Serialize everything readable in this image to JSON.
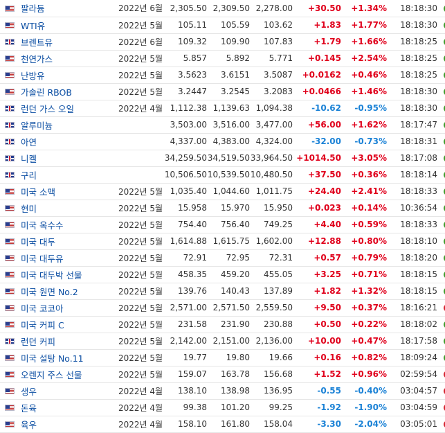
{
  "colors": {
    "positive": "#e0001b",
    "negative": "#1b82d6",
    "link": "#0a4da2",
    "open_clock": "#3b9b2a",
    "closed_clock": "#d4222d"
  },
  "rows": [
    {
      "flag": "us",
      "name": "팔라듐",
      "month": "2022년 6월",
      "last": "2,305.50",
      "high": "2,309.50",
      "low": "2,278.00",
      "chg": "+30.50",
      "pct": "+1.34%",
      "time": "18:18:30",
      "dir": "pos",
      "status": "open"
    },
    {
      "flag": "us",
      "name": "WTI유",
      "month": "2022년 5월",
      "last": "105.11",
      "high": "105.59",
      "low": "103.62",
      "chg": "+1.83",
      "pct": "+1.77%",
      "time": "18:18:30",
      "dir": "pos",
      "status": "open"
    },
    {
      "flag": "uk",
      "name": "브렌트유",
      "month": "2022년 6월",
      "last": "109.32",
      "high": "109.90",
      "low": "107.83",
      "chg": "+1.79",
      "pct": "+1.66%",
      "time": "18:18:25",
      "dir": "pos",
      "status": "open"
    },
    {
      "flag": "us",
      "name": "천연가스",
      "month": "2022년 5월",
      "last": "5.857",
      "high": "5.892",
      "low": "5.771",
      "chg": "+0.145",
      "pct": "+2.54%",
      "time": "18:18:25",
      "dir": "pos",
      "status": "open"
    },
    {
      "flag": "us",
      "name": "난방유",
      "month": "2022년 5월",
      "last": "3.5623",
      "high": "3.6151",
      "low": "3.5087",
      "chg": "+0.0162",
      "pct": "+0.46%",
      "time": "18:18:25",
      "dir": "pos",
      "status": "open"
    },
    {
      "flag": "us",
      "name": "가솔린 RBOB",
      "month": "2022년 5월",
      "last": "3.2447",
      "high": "3.2545",
      "low": "3.2083",
      "chg": "+0.0466",
      "pct": "+1.46%",
      "time": "18:18:30",
      "dir": "pos",
      "status": "open"
    },
    {
      "flag": "uk",
      "name": "런던 가스 오일",
      "month": "2022년 4월",
      "last": "1,112.38",
      "high": "1,139.63",
      "low": "1,094.38",
      "chg": "-10.62",
      "pct": "-0.95%",
      "time": "18:18:30",
      "dir": "neg",
      "status": "open"
    },
    {
      "flag": "uk",
      "name": "알루미늄",
      "month": "",
      "last": "3,503.00",
      "high": "3,516.00",
      "low": "3,477.00",
      "chg": "+56.00",
      "pct": "+1.62%",
      "time": "18:17:47",
      "dir": "pos",
      "status": "open"
    },
    {
      "flag": "uk",
      "name": "아연",
      "month": "",
      "last": "4,337.00",
      "high": "4,383.00",
      "low": "4,324.00",
      "chg": "-32.00",
      "pct": "-0.73%",
      "time": "18:18:31",
      "dir": "neg",
      "status": "open"
    },
    {
      "flag": "uk",
      "name": "니켈",
      "month": "",
      "last": "34,259.50",
      "high": "34,519.50",
      "low": "33,964.50",
      "chg": "+1014.50",
      "pct": "+3.05%",
      "time": "18:17:08",
      "dir": "pos",
      "status": "open"
    },
    {
      "flag": "uk",
      "name": "구리",
      "month": "",
      "last": "10,506.50",
      "high": "10,539.50",
      "low": "10,480.50",
      "chg": "+37.50",
      "pct": "+0.36%",
      "time": "18:18:14",
      "dir": "pos",
      "status": "open"
    },
    {
      "flag": "us",
      "name": "미국 소맥",
      "month": "2022년 5월",
      "last": "1,035.40",
      "high": "1,044.60",
      "low": "1,011.75",
      "chg": "+24.40",
      "pct": "+2.41%",
      "time": "18:18:33",
      "dir": "pos",
      "status": "open"
    },
    {
      "flag": "us",
      "name": "현미",
      "month": "2022년 5월",
      "last": "15.958",
      "high": "15.970",
      "low": "15.950",
      "chg": "+0.023",
      "pct": "+0.14%",
      "time": "10:36:54",
      "dir": "pos",
      "status": "open"
    },
    {
      "flag": "us",
      "name": "미국 옥수수",
      "month": "2022년 5월",
      "last": "754.40",
      "high": "756.40",
      "low": "749.25",
      "chg": "+4.40",
      "pct": "+0.59%",
      "time": "18:18:33",
      "dir": "pos",
      "status": "open"
    },
    {
      "flag": "us",
      "name": "미국 대두",
      "month": "2022년 5월",
      "last": "1,614.88",
      "high": "1,615.75",
      "low": "1,602.00",
      "chg": "+12.88",
      "pct": "+0.80%",
      "time": "18:18:10",
      "dir": "pos",
      "status": "open"
    },
    {
      "flag": "us",
      "name": "미국 대두유",
      "month": "2022년 5월",
      "last": "72.91",
      "high": "72.95",
      "low": "72.31",
      "chg": "+0.57",
      "pct": "+0.79%",
      "time": "18:18:20",
      "dir": "pos",
      "status": "open"
    },
    {
      "flag": "us",
      "name": "미국 대두박 선물",
      "month": "2022년 5월",
      "last": "458.35",
      "high": "459.20",
      "low": "455.05",
      "chg": "+3.25",
      "pct": "+0.71%",
      "time": "18:18:15",
      "dir": "pos",
      "status": "open"
    },
    {
      "flag": "us",
      "name": "미국 원면 No.2",
      "month": "2022년 5월",
      "last": "139.76",
      "high": "140.43",
      "low": "137.89",
      "chg": "+1.82",
      "pct": "+1.32%",
      "time": "18:18:15",
      "dir": "pos",
      "status": "open"
    },
    {
      "flag": "us",
      "name": "미국 코코아",
      "month": "2022년 5월",
      "last": "2,571.00",
      "high": "2,571.50",
      "low": "2,559.50",
      "chg": "+9.50",
      "pct": "+0.37%",
      "time": "18:16:21",
      "dir": "pos",
      "status": "closed"
    },
    {
      "flag": "us",
      "name": "미국 커피 C",
      "month": "2022년 5월",
      "last": "231.58",
      "high": "231.90",
      "low": "230.88",
      "chg": "+0.50",
      "pct": "+0.22%",
      "time": "18:18:02",
      "dir": "pos",
      "status": "open"
    },
    {
      "flag": "uk",
      "name": "런던 커피",
      "month": "2022년 5월",
      "last": "2,142.00",
      "high": "2,151.00",
      "low": "2,136.00",
      "chg": "+10.00",
      "pct": "+0.47%",
      "time": "18:17:58",
      "dir": "pos",
      "status": "open"
    },
    {
      "flag": "us",
      "name": "미국 설탕 No.11",
      "month": "2022년 5월",
      "last": "19.77",
      "high": "19.80",
      "low": "19.66",
      "chg": "+0.16",
      "pct": "+0.82%",
      "time": "18:09:24",
      "dir": "pos",
      "status": "open"
    },
    {
      "flag": "us",
      "name": "오렌지 주스 선물",
      "month": "2022년 5월",
      "last": "159.07",
      "high": "163.78",
      "low": "156.68",
      "chg": "+1.52",
      "pct": "+0.96%",
      "time": "02:59:54",
      "dir": "pos",
      "status": "closed"
    },
    {
      "flag": "us",
      "name": "생우",
      "month": "2022년 4월",
      "last": "138.10",
      "high": "138.98",
      "low": "136.95",
      "chg": "-0.55",
      "pct": "-0.40%",
      "time": "03:04:57",
      "dir": "neg",
      "status": "closed"
    },
    {
      "flag": "us",
      "name": "돈육",
      "month": "2022년 4월",
      "last": "99.38",
      "high": "101.20",
      "low": "99.25",
      "chg": "-1.92",
      "pct": "-1.90%",
      "time": "03:04:59",
      "dir": "neg",
      "status": "closed"
    },
    {
      "flag": "us",
      "name": "육우",
      "month": "2022년 4월",
      "last": "158.10",
      "high": "161.80",
      "low": "158.04",
      "chg": "-3.30",
      "pct": "-2.04%",
      "time": "03:05:01",
      "dir": "neg",
      "status": "closed"
    }
  ]
}
